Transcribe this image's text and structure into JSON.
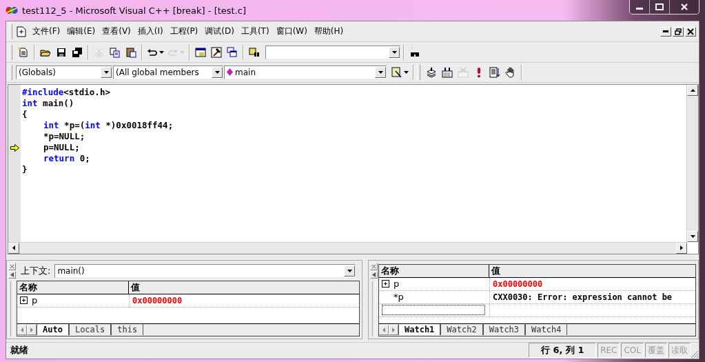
{
  "window": {
    "title": "test112_5 - Microsoft Visual C++ [break] - [test.c]"
  },
  "menu": [
    "文件(F)",
    "编辑(E)",
    "查看(V)",
    "插入(I)",
    "工程(P)",
    "调试(D)",
    "工具(T)",
    "窗口(W)",
    "帮助(H)"
  ],
  "standard_toolbar": [
    {
      "disabled": false
    },
    {
      "disabled": false
    },
    {
      "disabled": false
    },
    {
      "disabled": false
    },
    {
      "disabled": true
    },
    {
      "disabled": false
    },
    {
      "disabled": false
    },
    {
      "disabled": false
    },
    {
      "disabled": true
    },
    {
      "disabled": false
    },
    {
      "disabled": false
    },
    {
      "disabled": false
    },
    {
      "disabled": false
    }
  ],
  "wizard_bar": {
    "class": "(Globals)",
    "filter": "(All global members",
    "member": "main"
  },
  "build_toolbar": [
    {
      "disabled": false
    },
    {
      "disabled": false
    },
    {
      "disabled": true
    },
    {
      "disabled": false
    },
    {
      "disabled": false
    },
    {
      "disabled": false
    }
  ],
  "code": [
    {
      "current": false,
      "indented": false,
      "tokens": [
        {
          "kind": "keyword",
          "text": "#include"
        },
        {
          "kind": "plain",
          "text": "<stdio.h>"
        }
      ]
    },
    {
      "current": false,
      "indented": false,
      "tokens": [
        {
          "kind": "keyword",
          "text": "int"
        },
        {
          "kind": "plain",
          "text": " main()"
        }
      ]
    },
    {
      "current": false,
      "indented": false,
      "tokens": [
        {
          "kind": "plain",
          "text": "{"
        }
      ]
    },
    {
      "current": false,
      "indented": true,
      "tokens": [
        {
          "kind": "keyword",
          "text": "int"
        },
        {
          "kind": "plain",
          "text": " *p=("
        },
        {
          "kind": "keyword",
          "text": "int"
        },
        {
          "kind": "plain",
          "text": " *)0x0018ff44;"
        }
      ]
    },
    {
      "current": false,
      "indented": true,
      "tokens": [
        {
          "kind": "plain",
          "text": "*p=NULL;"
        }
      ]
    },
    {
      "current": true,
      "indented": true,
      "tokens": [
        {
          "kind": "plain",
          "text": "p=NULL;"
        }
      ]
    },
    {
      "current": false,
      "indented": true,
      "tokens": [
        {
          "kind": "keyword",
          "text": "return"
        },
        {
          "kind": "plain",
          "text": " 0;"
        }
      ]
    },
    {
      "current": false,
      "indented": false,
      "tokens": [
        {
          "kind": "plain",
          "text": "}"
        }
      ]
    }
  ],
  "variables": {
    "context_label": "上下文:",
    "context_value": "main()",
    "columns": [
      "名称",
      "值"
    ],
    "rows": [
      {
        "name": "p",
        "expandable": true,
        "value": "0x00000000",
        "changed": true
      }
    ],
    "tabs": [
      {
        "label": "Auto",
        "selected": true
      },
      {
        "label": "Locals",
        "selected": false
      },
      {
        "label": "this",
        "selected": false
      }
    ]
  },
  "watch": {
    "columns": [
      "名称",
      "值"
    ],
    "rows": [
      {
        "name": "p",
        "expandable": true,
        "value": "0x00000000",
        "changed": true
      },
      {
        "name": "*p",
        "expandable": false,
        "value": "CXX0030: Error: expression cannot be",
        "changed": false
      }
    ],
    "tabs": [
      {
        "label": "Watch1",
        "selected": true
      },
      {
        "label": "Watch2",
        "selected": false
      },
      {
        "label": "Watch3",
        "selected": false
      },
      {
        "label": "Watch4",
        "selected": false
      }
    ]
  },
  "status_bar": {
    "message": "就绪",
    "position": "行 6, 列 1",
    "indicators": [
      "REC",
      "COL",
      "覆盖",
      "读取"
    ]
  }
}
